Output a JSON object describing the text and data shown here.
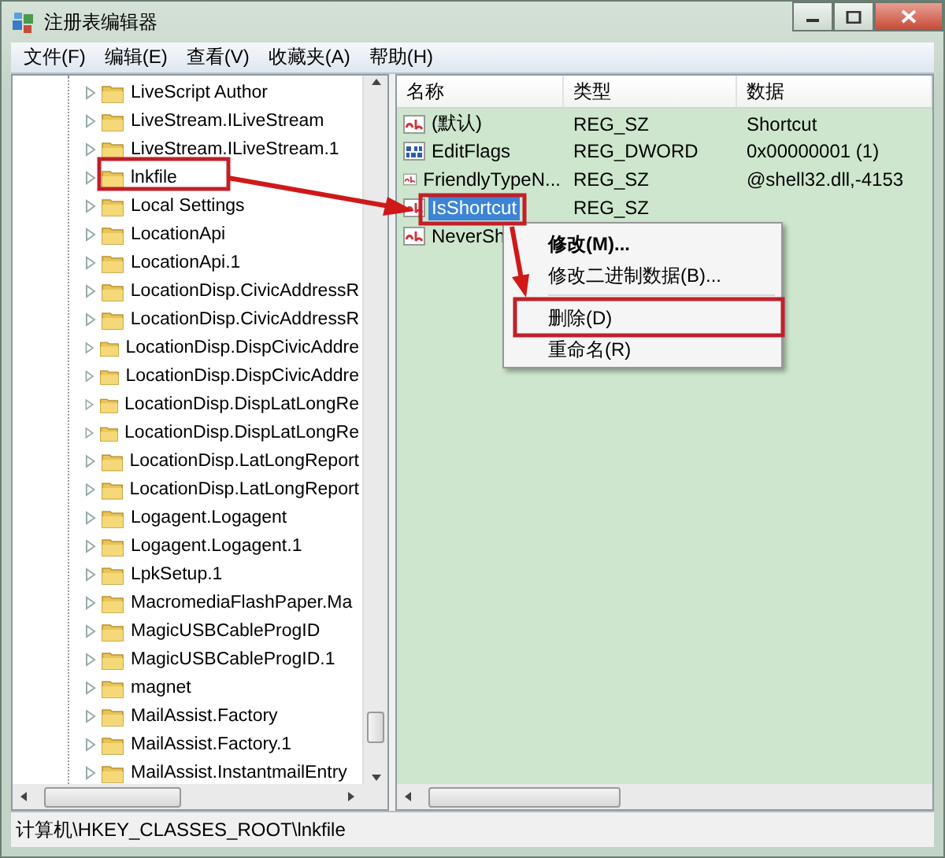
{
  "window": {
    "title": "注册表编辑器"
  },
  "menu_bar": [
    "文件(F)",
    "编辑(E)",
    "查看(V)",
    "收藏夹(A)",
    "帮助(H)"
  ],
  "tree": {
    "items": [
      {
        "label": "LiveScript Author"
      },
      {
        "label": "LiveStream.ILiveStream"
      },
      {
        "label": "LiveStream.ILiveStream.1"
      },
      {
        "label": "lnkfile"
      },
      {
        "label": "Local Settings"
      },
      {
        "label": "LocationApi"
      },
      {
        "label": "LocationApi.1"
      },
      {
        "label": "LocationDisp.CivicAddressR"
      },
      {
        "label": "LocationDisp.CivicAddressR"
      },
      {
        "label": "LocationDisp.DispCivicAddre"
      },
      {
        "label": "LocationDisp.DispCivicAddre"
      },
      {
        "label": "LocationDisp.DispLatLongRe"
      },
      {
        "label": "LocationDisp.DispLatLongRe"
      },
      {
        "label": "LocationDisp.LatLongReport"
      },
      {
        "label": "LocationDisp.LatLongReport"
      },
      {
        "label": "Logagent.Logagent"
      },
      {
        "label": "Logagent.Logagent.1"
      },
      {
        "label": "LpkSetup.1"
      },
      {
        "label": "MacromediaFlashPaper.Ma"
      },
      {
        "label": "MagicUSBCableProgID"
      },
      {
        "label": "MagicUSBCableProgID.1"
      },
      {
        "label": "magnet"
      },
      {
        "label": "MailAssist.Factory"
      },
      {
        "label": "MailAssist.Factory.1"
      },
      {
        "label": "MailAssist.InstantmailEntry"
      }
    ]
  },
  "values": {
    "columns": [
      "名称",
      "类型",
      "数据"
    ],
    "rows": [
      {
        "kind": "string",
        "name": "(默认)",
        "type": "REG_SZ",
        "data": "Shortcut",
        "selected": false
      },
      {
        "kind": "binary",
        "name": "EditFlags",
        "type": "REG_DWORD",
        "data": "0x00000001 (1)",
        "selected": false
      },
      {
        "kind": "string",
        "name": "FriendlyTypeN...",
        "type": "REG_SZ",
        "data": "@shell32.dll,-4153",
        "selected": false
      },
      {
        "kind": "string",
        "name": "IsShortcut",
        "type": "REG_SZ",
        "selected": true
      },
      {
        "kind": "string",
        "name": "NeverSh",
        "selected": false
      }
    ]
  },
  "context_menu": [
    {
      "kind": "item",
      "label": "修改(M)...",
      "default": true
    },
    {
      "kind": "item",
      "label": "修改二进制数据(B)...",
      "default": false
    },
    {
      "kind": "separator"
    },
    {
      "kind": "item",
      "label": "删除(D)",
      "default": false
    },
    {
      "kind": "item",
      "label": "重命名(R)",
      "default": false
    }
  ],
  "status_bar": "计算机\\HKEY_CLASSES_ROOT\\lnkfile"
}
